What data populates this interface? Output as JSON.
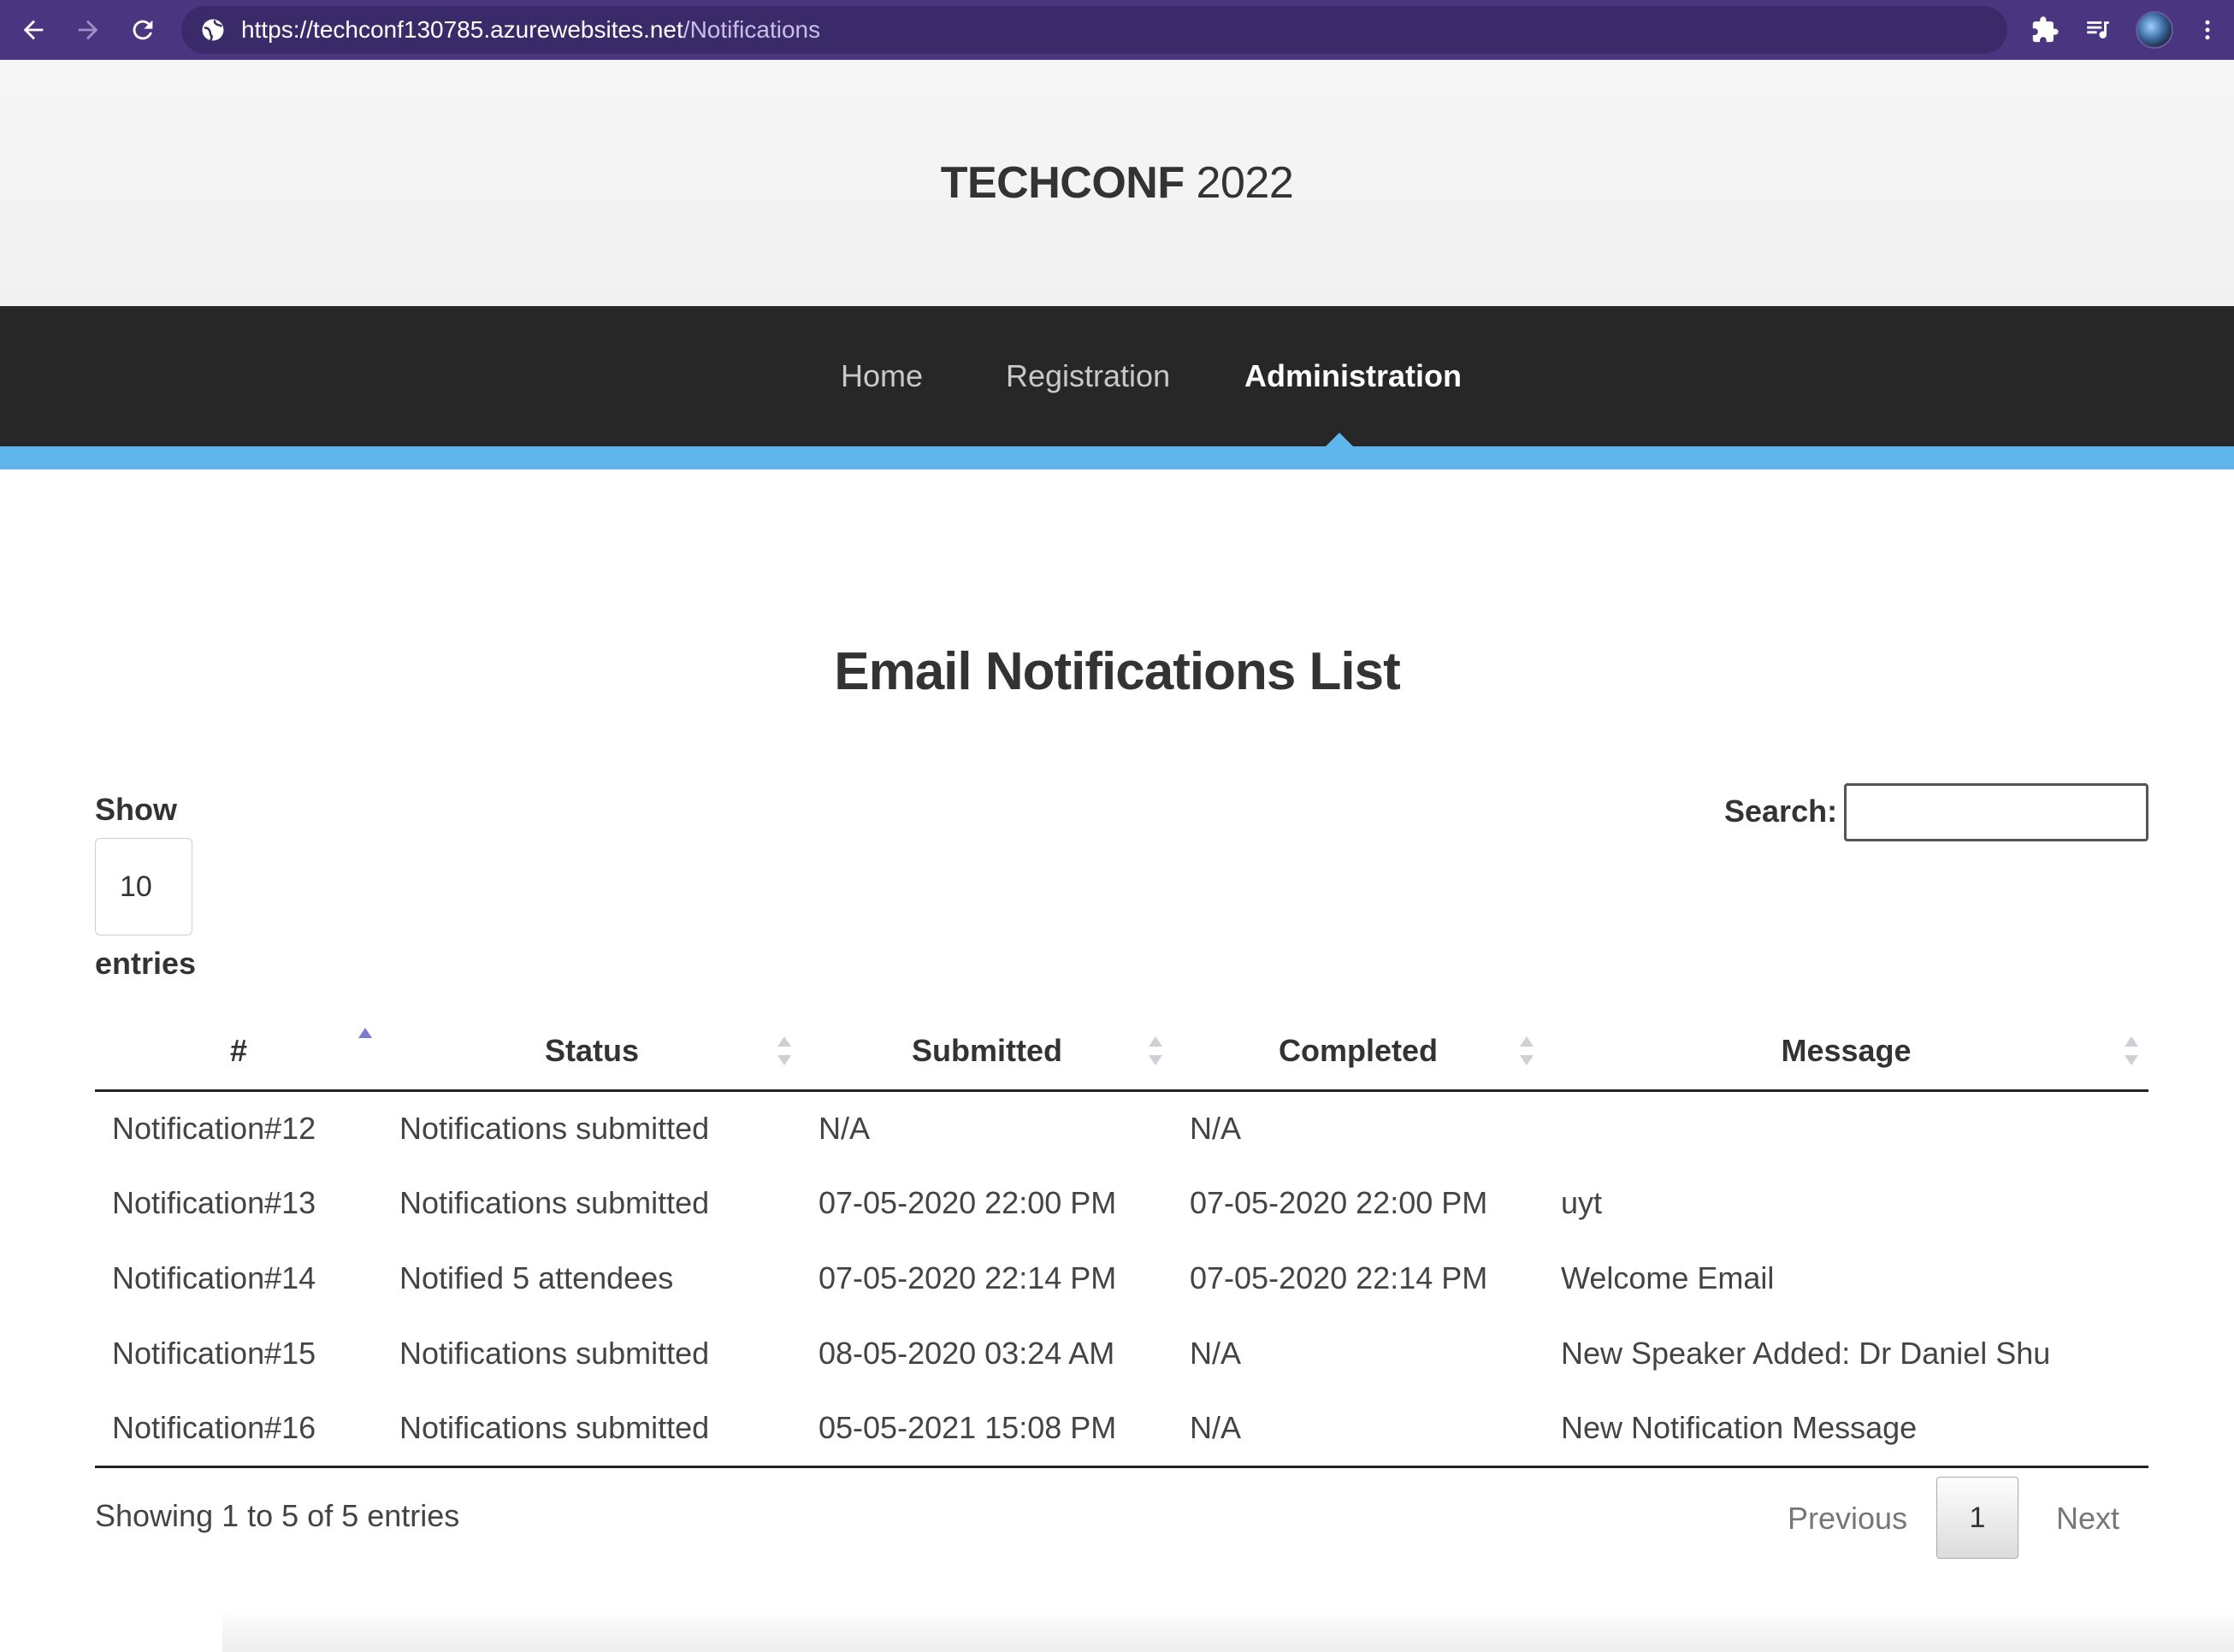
{
  "browser": {
    "url_host": "https://techconf130785.azurewebsites.net",
    "url_path": "/Notifications"
  },
  "header": {
    "brand_bold": "TECHCONF",
    "brand_year": " 2022"
  },
  "nav": {
    "items": [
      {
        "label": "Home"
      },
      {
        "label": "Registration"
      },
      {
        "label": "Administration"
      }
    ]
  },
  "page": {
    "title": "Email Notifications List"
  },
  "table_controls": {
    "show_label": "Show",
    "page_length": "10",
    "entries_label": "entries",
    "search_label": "Search:",
    "search_value": ""
  },
  "table": {
    "columns": [
      "#",
      "Status",
      "Submitted",
      "Completed",
      "Message"
    ],
    "sorted_column": "#",
    "sort_direction": "ascending",
    "rows": [
      {
        "id": "Notification#12",
        "status": "Notifications submitted",
        "submitted": "N/A",
        "completed": "N/A",
        "message": ""
      },
      {
        "id": "Notification#13",
        "status": "Notifications submitted",
        "submitted": "07-05-2020 22:00 PM",
        "completed": "07-05-2020 22:00 PM",
        "message": "uyt"
      },
      {
        "id": "Notification#14",
        "status": "Notified 5 attendees",
        "submitted": "07-05-2020 22:14 PM",
        "completed": "07-05-2020 22:14 PM",
        "message": "Welcome Email"
      },
      {
        "id": "Notification#15",
        "status": "Notifications submitted",
        "submitted": "08-05-2020 03:24 AM",
        "completed": "N/A",
        "message": "New Speaker Added: Dr Daniel Shu"
      },
      {
        "id": "Notification#16",
        "status": "Notifications submitted",
        "submitted": "05-05-2021 15:08 PM",
        "completed": "N/A",
        "message": "New Notification Message"
      }
    ]
  },
  "footer": {
    "info": "Showing 1 to 5 of 5 entries",
    "previous": "Previous",
    "current_page": "1",
    "next": "Next"
  },
  "icons": {
    "back": "arrow-left-icon",
    "forward": "arrow-right-icon",
    "reload": "reload-icon",
    "site": "globe-icon",
    "extensions": "puzzle-icon",
    "reading_list": "reading-list-icon",
    "profile": "avatar",
    "menu": "more-vertical-icon"
  },
  "colors": {
    "browser_bar": "#4a3680",
    "nav_background": "#272727",
    "nav_accent": "#5fb6ec",
    "sort_active": "#7b7bd0"
  }
}
